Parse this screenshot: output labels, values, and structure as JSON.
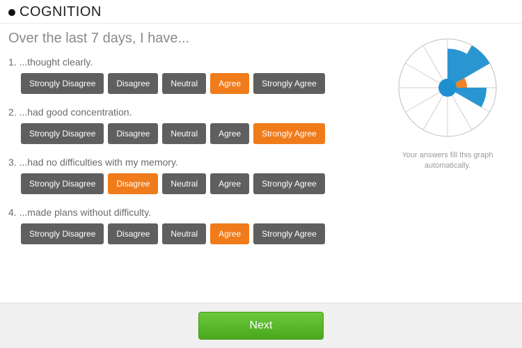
{
  "section_title": "COGNITION",
  "prompt": "Over the last 7 days, I have...",
  "option_labels": [
    "Strongly Disagree",
    "Disagree",
    "Neutral",
    "Agree",
    "Strongly Agree"
  ],
  "questions": [
    {
      "num": "1.",
      "text": "...thought clearly.",
      "selected": 3
    },
    {
      "num": "2.",
      "text": "...had good concentration.",
      "selected": 4
    },
    {
      "num": "3.",
      "text": "...had no difficulties with my memory.",
      "selected": 1
    },
    {
      "num": "4.",
      "text": "...made plans without difficulty.",
      "selected": 3
    }
  ],
  "graph_caption": "Your answers fill this graph automatically.",
  "next_label": "Next",
  "colors": {
    "accent": "#f07b1a",
    "button": "#5f5f5f",
    "blue": "#1e90d0"
  },
  "chart_data": {
    "type": "radar",
    "spokes": 12,
    "max": 5,
    "answered_slice_start": 0,
    "answered_slice_count": 4,
    "values": [
      4,
      5,
      2,
      4
    ],
    "colors": [
      "#1e90d0",
      "#1e90d0",
      "#f07b1a",
      "#1e90d0"
    ]
  }
}
